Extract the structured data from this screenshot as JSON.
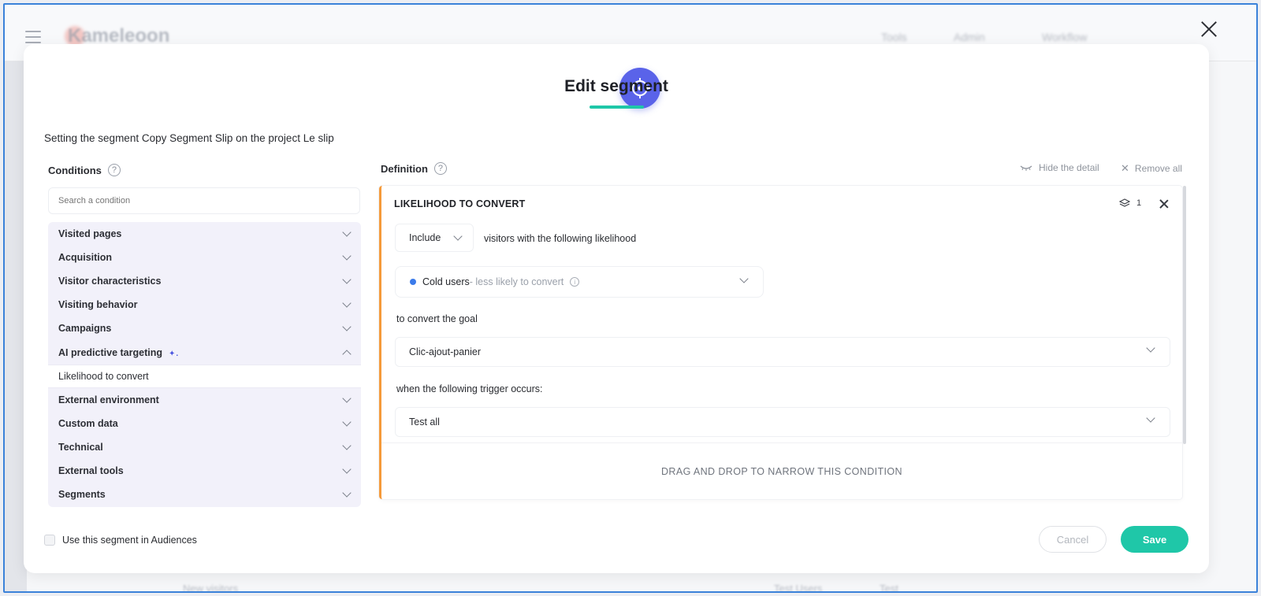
{
  "background_app": {
    "logo": "Kameleoon",
    "nav": [
      "Tools",
      "Admin",
      "Workflow"
    ],
    "bottom_text": [
      "New visitors",
      "Test Users",
      "Test"
    ]
  },
  "modal": {
    "title": "Edit segment",
    "subtitle": "Setting the segment Copy Segment Slip on the project Le slip"
  },
  "conditions": {
    "header": "Conditions",
    "search_placeholder": "Search a condition",
    "items": [
      {
        "label": "Visited pages",
        "expanded": false
      },
      {
        "label": "Acquisition",
        "expanded": false
      },
      {
        "label": "Visitor characteristics",
        "expanded": false
      },
      {
        "label": "Visiting behavior",
        "expanded": false
      },
      {
        "label": "Campaigns",
        "expanded": false
      },
      {
        "label": "AI predictive targeting",
        "expanded": true
      },
      {
        "label": "External environment",
        "expanded": false
      },
      {
        "label": "Custom data",
        "expanded": false
      },
      {
        "label": "Technical",
        "expanded": false
      },
      {
        "label": "External tools",
        "expanded": false
      },
      {
        "label": "Segments",
        "expanded": false
      }
    ],
    "ai_sub_item": "Likelihood to convert"
  },
  "definition": {
    "header": "Definition",
    "hide_detail": "Hide the detail",
    "remove_all": "Remove all",
    "card": {
      "title": "LIKELIHOOD TO CONVERT",
      "layer_count": "1",
      "include_value": "Include",
      "include_text": "visitors with the following likelihood",
      "likelihood_main": "Cold users",
      "likelihood_sub": " - less likely to convert",
      "goal_label": "to convert the goal",
      "goal_value": "Clic-ajout-panier",
      "trigger_label": "when the following trigger occurs:",
      "trigger_value": "Test all",
      "drop_zone": "DRAG AND DROP TO NARROW THIS CONDITION"
    }
  },
  "footer": {
    "audience_checkbox": "Use this segment in Audiences",
    "cancel": "Cancel",
    "save": "Save"
  },
  "colors": {
    "accent": "#1fc7a8",
    "badge": "#5a63e9",
    "card_border": "#f59a3a",
    "dot": "#3b7bea"
  }
}
